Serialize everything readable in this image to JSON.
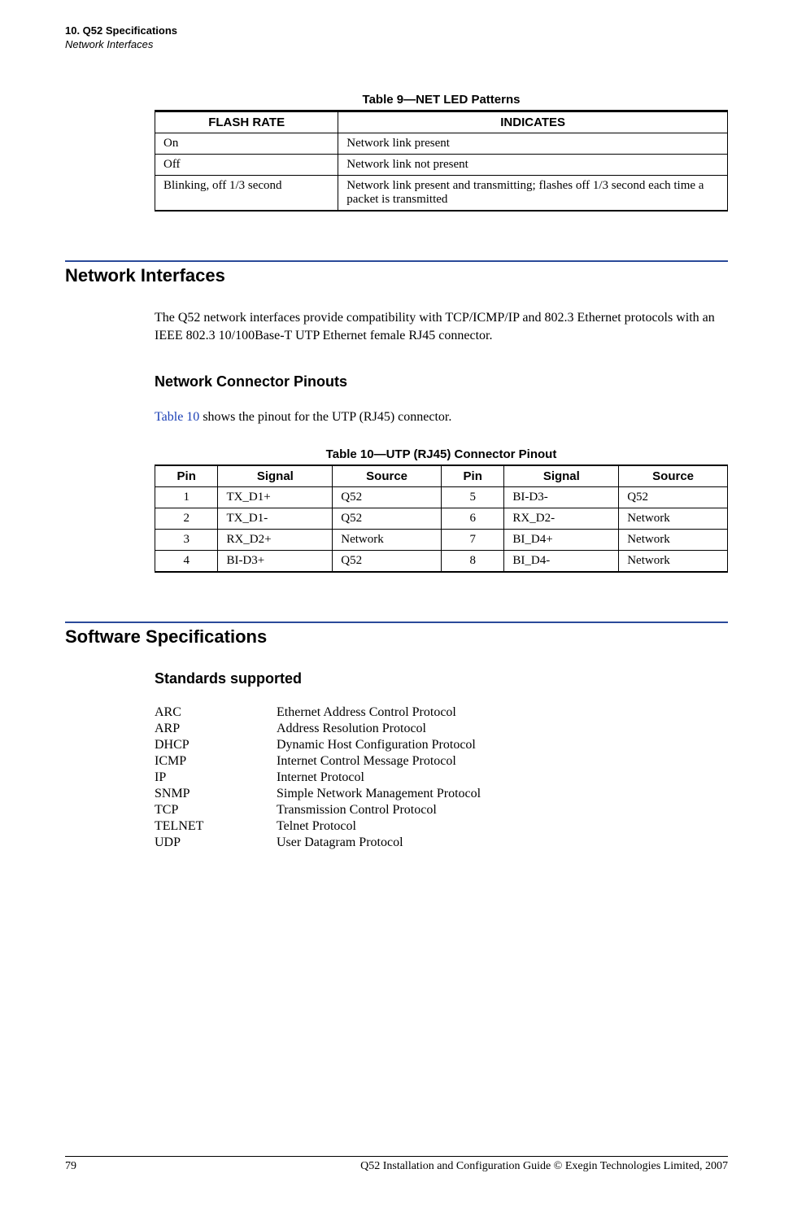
{
  "running_head": {
    "chapter": "10. Q52 Specifications",
    "section": "Network Interfaces"
  },
  "table9": {
    "caption": "Table 9—NET LED Patterns",
    "headers": {
      "col1": "FLASH RATE",
      "col2": "INDICATES"
    },
    "rows": [
      {
        "rate": "On",
        "ind": "Network link present"
      },
      {
        "rate": "Off",
        "ind": "Network link not present"
      },
      {
        "rate": "Blinking, off 1/3 second",
        "ind": "Network link present and transmitting; flashes off 1/3 second each time a packet is transmitted"
      }
    ]
  },
  "section1": {
    "title": "Network Interfaces",
    "para": "The Q52 network interfaces provide compatibility with TCP/ICMP/IP and 802.3 Ethernet protocols with an IEEE 802.3 10/100Base-T UTP Ethernet female RJ45 connector."
  },
  "pinouts": {
    "title": "Network Connector Pinouts",
    "para_pre": "",
    "link": "Table 10",
    "para_post": " shows the pinout for the UTP (RJ45) connector."
  },
  "table10": {
    "caption": "Table 10—UTP (RJ45) Connector Pinout",
    "headers": {
      "pin": "Pin",
      "signal": "Signal",
      "source": "Source"
    },
    "rows": [
      {
        "p1": "1",
        "s1": "TX_D1+",
        "src1": "Q52",
        "p2": "5",
        "s2": "BI-D3-",
        "src2": "Q52"
      },
      {
        "p1": "2",
        "s1": "TX_D1-",
        "src1": "Q52",
        "p2": "6",
        "s2": "RX_D2-",
        "src2": "Network"
      },
      {
        "p1": "3",
        "s1": "RX_D2+",
        "src1": "Network",
        "p2": "7",
        "s2": "BI_D4+",
        "src2": "Network"
      },
      {
        "p1": "4",
        "s1": "BI-D3+",
        "src1": "Q52",
        "p2": "8",
        "s2": "BI_D4-",
        "src2": "Network"
      }
    ]
  },
  "section2": {
    "title": "Software Specifications"
  },
  "standards": {
    "title": "Standards supported",
    "items": [
      {
        "abbr": "ARC",
        "desc": "Ethernet Address Control Protocol"
      },
      {
        "abbr": "ARP",
        "desc": "Address Resolution Protocol"
      },
      {
        "abbr": "DHCP",
        "desc": "Dynamic Host Configuration Protocol"
      },
      {
        "abbr": "ICMP",
        "desc": "Internet Control Message Protocol"
      },
      {
        "abbr": "IP",
        "desc": "Internet Protocol"
      },
      {
        "abbr": "SNMP",
        "desc": "Simple Network Management Protocol"
      },
      {
        "abbr": "TCP",
        "desc": "Transmission Control Protocol"
      },
      {
        "abbr": "TELNET",
        "desc": "Telnet Protocol"
      },
      {
        "abbr": "UDP",
        "desc": "User Datagram Protocol"
      }
    ]
  },
  "footer": {
    "page": "79",
    "text": "Q52 Installation and Configuration Guide  © Exegin Technologies Limited, 2007"
  }
}
